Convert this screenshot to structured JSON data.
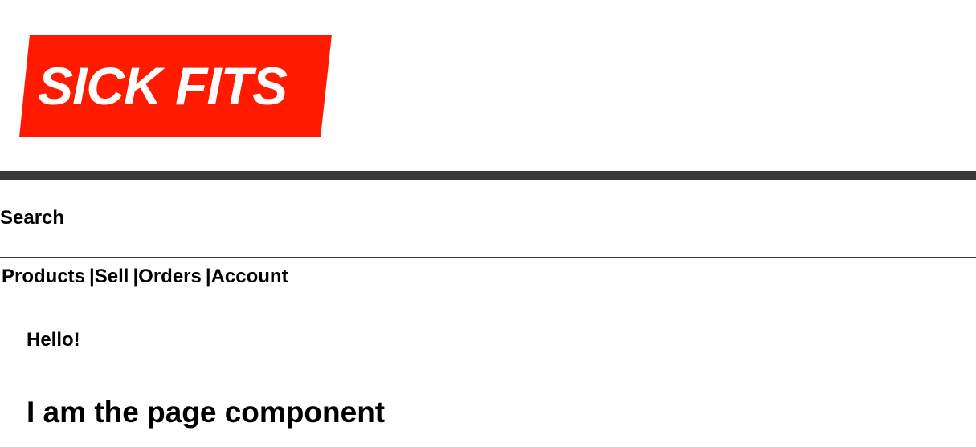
{
  "brand": {
    "logo_text": "SICK FITS",
    "logo_color": "#ff1a00",
    "logo_text_color": "#ffffff",
    "bar_color": "#393939"
  },
  "search": {
    "label": "Search"
  },
  "nav": {
    "items": [
      {
        "label": "Products"
      },
      {
        "label": "Sell"
      },
      {
        "label": "Orders"
      },
      {
        "label": "Account"
      }
    ],
    "separator": "|"
  },
  "main": {
    "greeting": "Hello!",
    "title": "I am the page component"
  }
}
